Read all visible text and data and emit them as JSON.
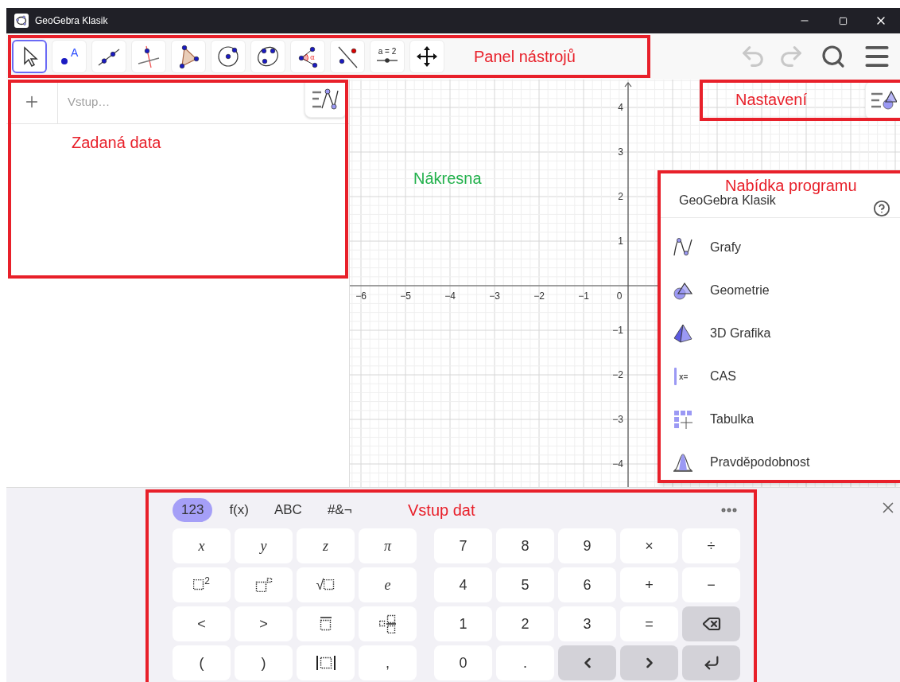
{
  "window": {
    "title": "GeoGebra Klasik"
  },
  "toolbar": {
    "tools": [
      {
        "kind": "move",
        "selected": true
      },
      {
        "kind": "point",
        "selected": false,
        "label": "A"
      },
      {
        "kind": "line",
        "selected": false
      },
      {
        "kind": "perpendicular",
        "selected": false
      },
      {
        "kind": "polygon",
        "selected": false
      },
      {
        "kind": "circle",
        "selected": false
      },
      {
        "kind": "conic",
        "selected": false
      },
      {
        "kind": "angle",
        "selected": false,
        "label": "α"
      },
      {
        "kind": "reflect",
        "selected": false
      },
      {
        "kind": "slider",
        "selected": false,
        "label": "a = 2"
      },
      {
        "kind": "pan",
        "selected": false
      }
    ],
    "undo": {
      "disabled": true
    },
    "redo": {
      "disabled": true
    }
  },
  "algebra": {
    "input_placeholder": "Vstup…"
  },
  "graphics": {
    "x_labels": [
      "−6",
      "−5",
      "−4",
      "−3",
      "−2",
      "−1"
    ],
    "origin_label": "0",
    "y_labels_positive": [
      "4",
      "3",
      "2",
      "1"
    ],
    "y_labels_negative": [
      "−1",
      "−2",
      "−3",
      "−4"
    ]
  },
  "perspectives": {
    "title": "GeoGebra Klasik",
    "items": [
      {
        "kind": "graphing",
        "label": "Grafy"
      },
      {
        "kind": "geometry",
        "label": "Geometrie"
      },
      {
        "kind": "solid",
        "label": "3D Grafika"
      },
      {
        "kind": "cas",
        "label": "CAS",
        "icon_text": "x="
      },
      {
        "kind": "spreadsheet",
        "label": "Tabulka"
      },
      {
        "kind": "probability",
        "label": "Pravděpodobnost"
      }
    ]
  },
  "keyboard": {
    "tabs": [
      {
        "label": "123",
        "selected": true
      },
      {
        "label": "f(x)",
        "selected": false
      },
      {
        "label": "ABC",
        "selected": false
      },
      {
        "label": "#&¬",
        "selected": false
      }
    ],
    "left_keys": [
      {
        "kind": "var",
        "label": "x"
      },
      {
        "kind": "var",
        "label": "y"
      },
      {
        "kind": "var",
        "label": "z"
      },
      {
        "kind": "var",
        "label": "π"
      },
      {
        "kind": "power",
        "label": "2"
      },
      {
        "kind": "power_box"
      },
      {
        "kind": "sqrt",
        "label": "√"
      },
      {
        "kind": "var",
        "label": "e"
      },
      {
        "kind": "text",
        "label": "<"
      },
      {
        "kind": "text",
        "label": ">"
      },
      {
        "kind": "overline"
      },
      {
        "kind": "subscript"
      },
      {
        "kind": "text",
        "label": "("
      },
      {
        "kind": "text",
        "label": ")"
      },
      {
        "kind": "abs"
      },
      {
        "kind": "text",
        "label": ","
      }
    ],
    "right_keys": [
      {
        "kind": "text",
        "label": "7"
      },
      {
        "kind": "text",
        "label": "8"
      },
      {
        "kind": "text",
        "label": "9"
      },
      {
        "kind": "text",
        "label": "×"
      },
      {
        "kind": "text",
        "label": "÷"
      },
      {
        "kind": "text",
        "label": "4"
      },
      {
        "kind": "text",
        "label": "5"
      },
      {
        "kind": "text",
        "label": "6"
      },
      {
        "kind": "text",
        "label": "+"
      },
      {
        "kind": "text",
        "label": "−"
      },
      {
        "kind": "text",
        "label": "1"
      },
      {
        "kind": "text",
        "label": "2"
      },
      {
        "kind": "text",
        "label": "3"
      },
      {
        "kind": "text",
        "label": "="
      },
      {
        "kind": "backspace"
      },
      {
        "kind": "text",
        "label": "0"
      },
      {
        "kind": "text",
        "label": "."
      },
      {
        "kind": "left"
      },
      {
        "kind": "right"
      },
      {
        "kind": "enter"
      }
    ]
  },
  "annotations": [
    {
      "kind": "box",
      "label": "Panel nástrojů",
      "color": "#e8202a"
    },
    {
      "kind": "box",
      "label": "Nastavení",
      "color": "#e8202a"
    },
    {
      "kind": "box",
      "label": "Zadaná data",
      "color": "#e8202a"
    },
    {
      "kind": "label",
      "label": "Nákresna",
      "color": "#22b14c"
    },
    {
      "kind": "box",
      "label": "Nabídka programu",
      "color": "#e8202a"
    },
    {
      "kind": "box",
      "label": "Vstup dat",
      "color": "#e8202a"
    }
  ]
}
